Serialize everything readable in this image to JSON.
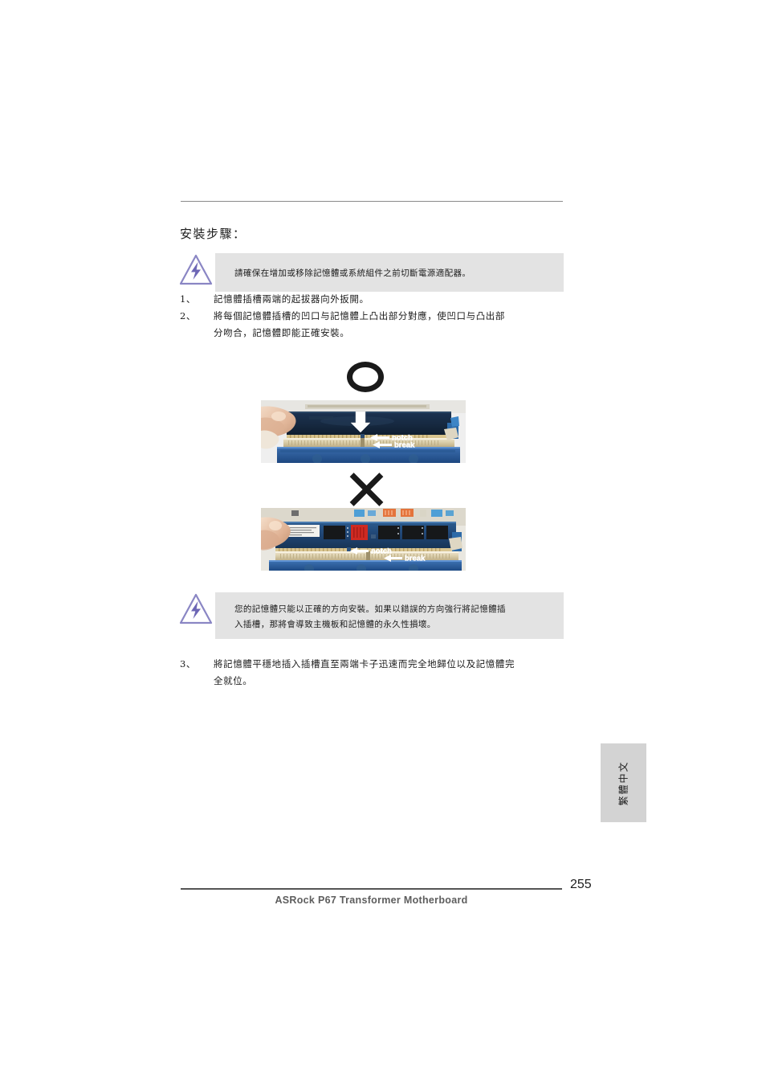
{
  "page": {
    "number": "255",
    "footer_title": "ASRock  P67 Transformer  Motherboard",
    "language_tab": "繁體中文"
  },
  "section": {
    "title": "安裝步驟："
  },
  "notes": [
    {
      "icon": "warning-triangle-icon",
      "text": "請確保在增加或移除記憶體或系統組件之前切斷電源適配器。"
    },
    {
      "icon": "warning-triangle-icon",
      "text": "您的記憶體只能以正確的方向安裝。如果以錯誤的方向強行將記憶體插\n入插槽，那將會導致主機板和記憶體的永久性損壞。"
    }
  ],
  "steps": [
    {
      "number": "1、",
      "text": "記憶體插槽兩端的起拔器向外扳開。"
    },
    {
      "number": "2、",
      "text": "將每個記憶體插槽的凹口与記憶體上凸出部分對應，使凹口与凸出部\n分吻合，記憶體即能正確安裝。"
    },
    {
      "number": "3、",
      "text": "將記憶體平穩地插入插槽直至兩端卡子迅速而完全地歸位以及記憶體完\n全就位。"
    }
  ],
  "figures": [
    {
      "mark": "circle-correct-mark",
      "caption_notch": "notch",
      "caption_break": "break",
      "description": "DIMM aligned correctly above slot"
    },
    {
      "mark": "cross-wrong-mark",
      "caption_notch": "notch",
      "caption_break": "break",
      "description": "DIMM aligned incorrectly above slot"
    }
  ],
  "colors": {
    "note_box": "#e3e3e3",
    "tab_box": "#d3d3d3",
    "rule": "#8a8a8a",
    "footer_text": "#5d5d5d",
    "mark": "#1a1a1a"
  }
}
